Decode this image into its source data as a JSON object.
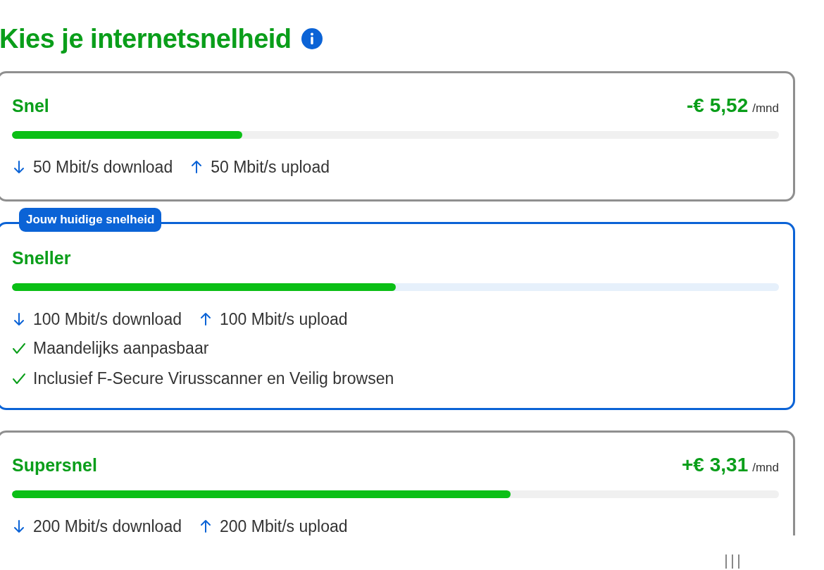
{
  "title": "Kies je internetsnelheid",
  "plans": [
    {
      "name": "Snel",
      "price": "-€ 5,52",
      "per": "/mnd",
      "level": 0.3,
      "selected": false,
      "download": "50 Mbit/s download",
      "upload": "50 Mbit/s upload"
    },
    {
      "name": "Sneller",
      "badge": "Jouw huidige snelheid",
      "level": 0.5,
      "selected": true,
      "download": "100 Mbit/s download",
      "upload": "100 Mbit/s upload",
      "features": [
        "Maandelijks aanpasbaar",
        "Inclusief F-Secure Virusscanner en Veilig browsen"
      ]
    },
    {
      "name": "Supersnel",
      "price": "+€ 3,31",
      "per": "/mnd",
      "level": 0.65,
      "selected": false,
      "download": "200 Mbit/s download",
      "upload": "200 Mbit/s upload"
    }
  ]
}
